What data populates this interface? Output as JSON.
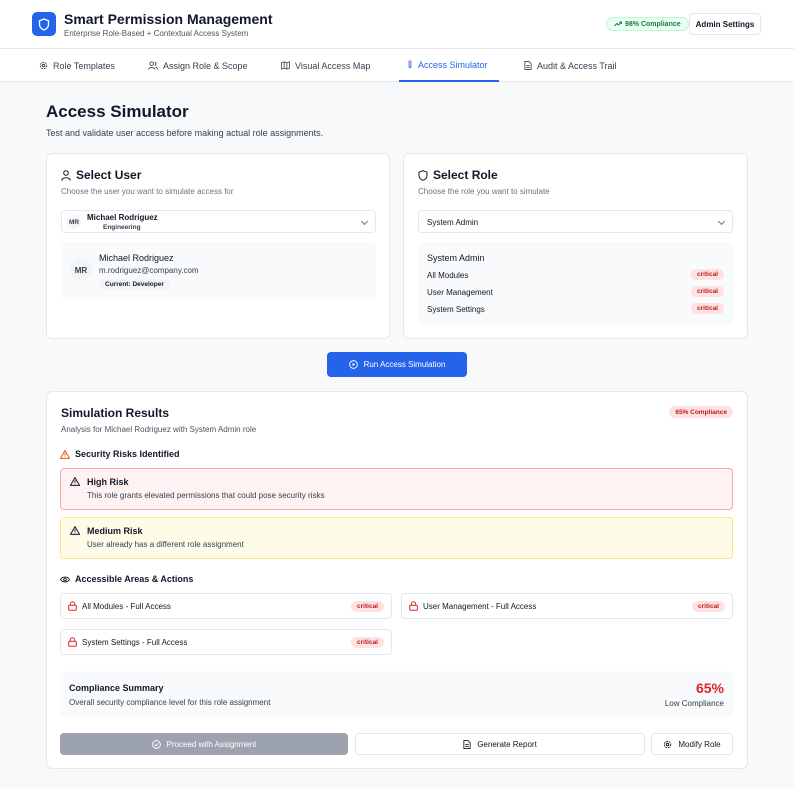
{
  "app": {
    "title": "Smart Permission Management",
    "subtitle": "Enterprise Role-Based + Contextual Access System",
    "compliance_badge": "98% Compliance",
    "admin_button": "Admin Settings"
  },
  "tabs": [
    {
      "label": "Role Templates",
      "icon": "gear-icon"
    },
    {
      "label": "Assign Role & Scope",
      "icon": "users-icon"
    },
    {
      "label": "Visual Access Map",
      "icon": "map-icon"
    },
    {
      "label": "Access Simulator",
      "icon": "flask-icon",
      "active": true
    },
    {
      "label": "Audit & Access Trail",
      "icon": "document-icon"
    }
  ],
  "page": {
    "title": "Access Simulator",
    "subtitle": "Test and validate user access before making actual role assignments."
  },
  "select_user": {
    "title": "Select User",
    "subtitle": "Choose the user you want to simulate access for",
    "selected": {
      "initials": "MR",
      "name": "Michael Rodriguez",
      "department": "Engineering"
    },
    "details": {
      "initials": "MR",
      "name": "Michael Rodriguez",
      "email": "m.rodriguez@company.com",
      "current_role": "Current: Developer"
    }
  },
  "select_role": {
    "title": "Select Role",
    "subtitle": "Choose the role you want to simulate",
    "selected": "System Admin",
    "details": {
      "name": "System Admin",
      "permissions": [
        {
          "label": "All Modules",
          "level": "critical"
        },
        {
          "label": "User Management",
          "level": "critical"
        },
        {
          "label": "System Settings",
          "level": "critical"
        }
      ]
    }
  },
  "run_button": "Run Access Simulation",
  "results": {
    "title": "Simulation Results",
    "subtitle": "Analysis for Michael Rodriguez with System Admin role",
    "compliance_badge": "65% Compliance",
    "risks_heading": "Security Risks Identified",
    "risks": [
      {
        "title": "High Risk",
        "desc": "This role grants elevated permissions that could pose security risks"
      },
      {
        "title": "Medium Risk",
        "desc": "User already has a different role assignment"
      }
    ],
    "areas_heading": "Accessible Areas & Actions",
    "areas": [
      {
        "label": "All Modules - Full Access",
        "level": "critical"
      },
      {
        "label": "User Management - Full Access",
        "level": "critical"
      },
      {
        "label": "System Settings - Full Access",
        "level": "critical"
      }
    ],
    "summary": {
      "title": "Compliance Summary",
      "desc": "Overall security compliance level for this role assignment",
      "value": "65%",
      "label": "Low Compliance"
    }
  },
  "actions": {
    "proceed": "Proceed with Assignment",
    "report": "Generate Report",
    "modify": "Modify Role"
  },
  "colors": {
    "accent": "#2563eb",
    "danger": "#dc2626",
    "warning_bg": "#fefce8",
    "danger_bg": "#fef2f2"
  }
}
